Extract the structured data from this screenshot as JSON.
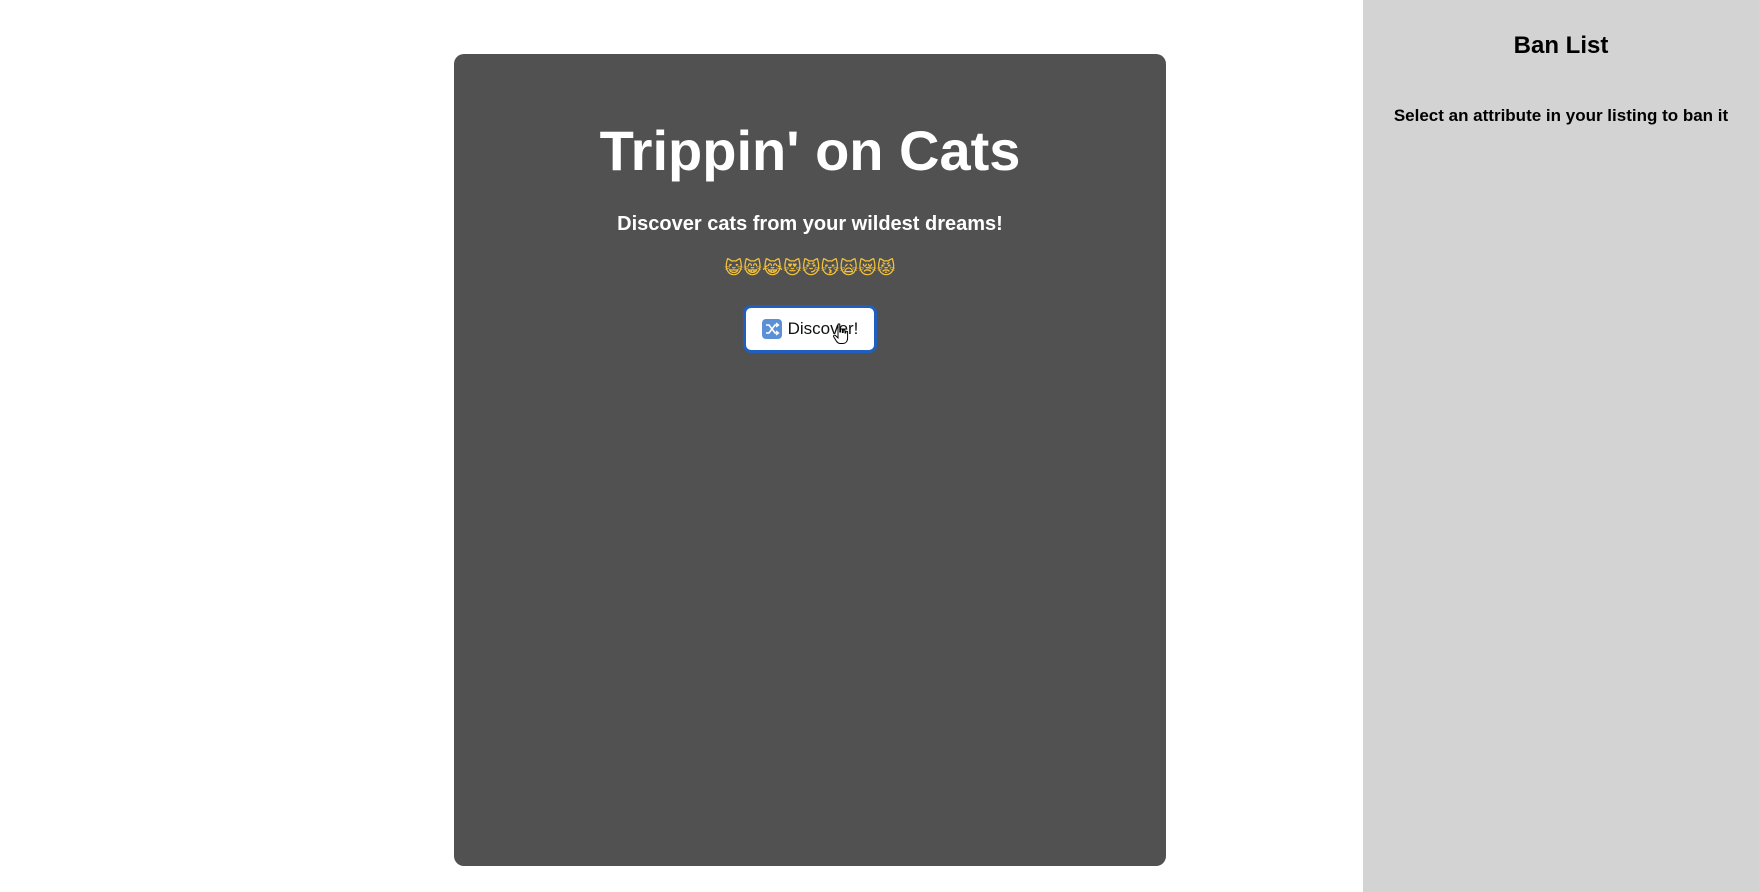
{
  "main": {
    "title": "Trippin' on Cats",
    "subtitle": "Discover cats from your wildest dreams!",
    "emojis": "😺😸😹😻😼😽🙀😿😾",
    "discover_label": "Discover!",
    "discover_icon": "shuffle-icon"
  },
  "sidebar": {
    "title": "Ban List",
    "instruction": "Select an attribute in your listing to ban it"
  },
  "colors": {
    "card_background": "#515151",
    "sidebar_background": "#d3d3d3",
    "button_border": "#1f5fbf"
  }
}
